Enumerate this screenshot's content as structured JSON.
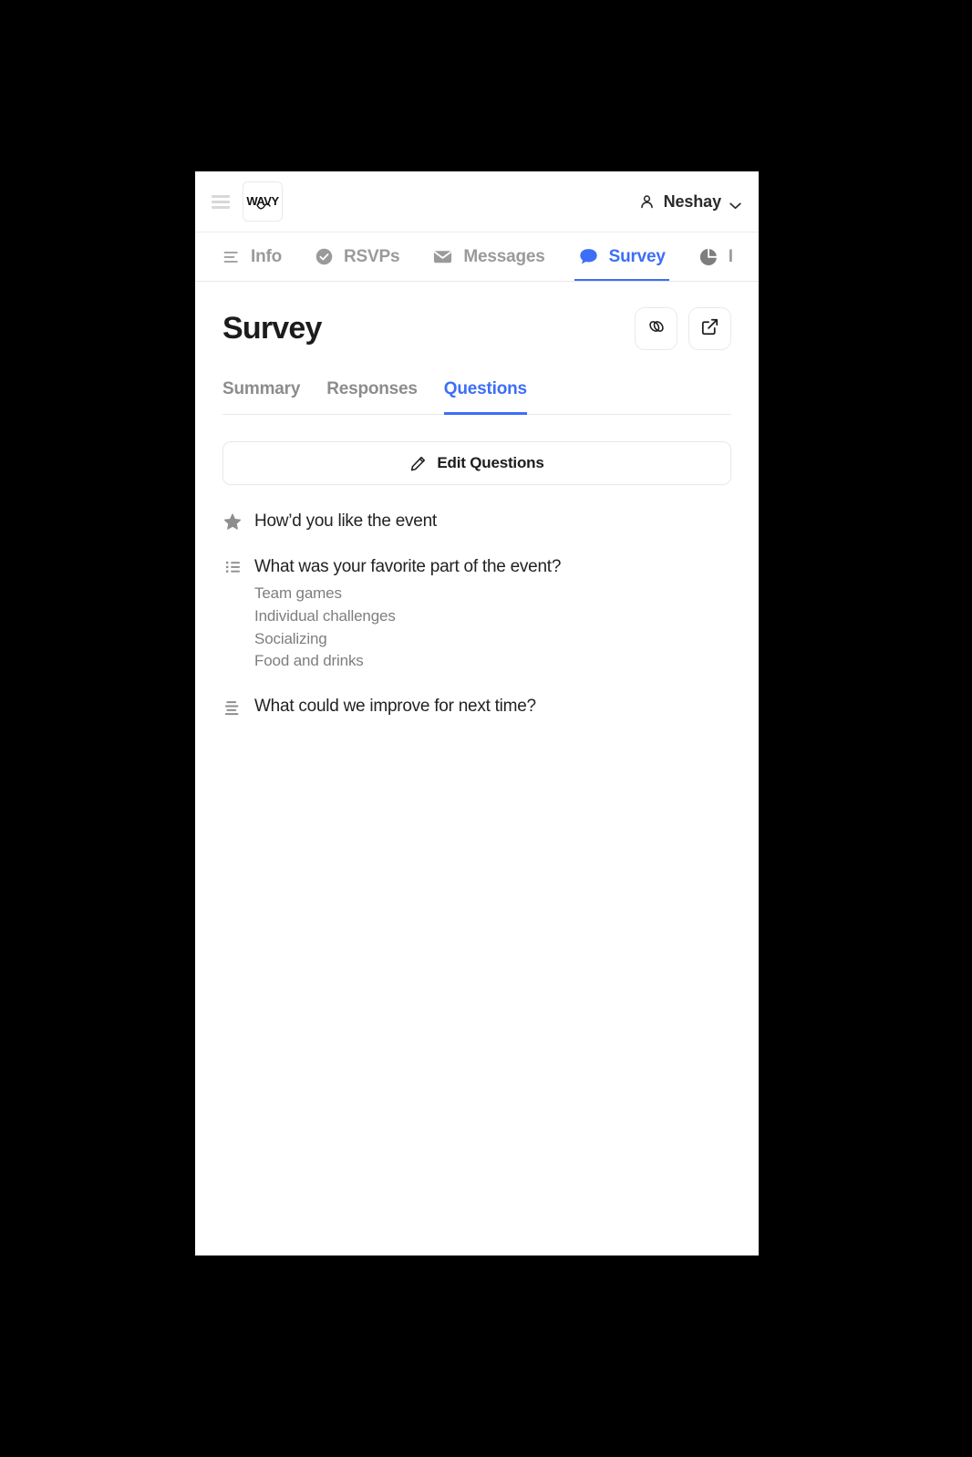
{
  "topbar": {
    "menu_icon": "hamburger-icon",
    "logo_text": "WAVY",
    "user_name": "Neshay",
    "user_icon": "person-icon",
    "chevron_icon": "chevron-down-icon"
  },
  "nav_tabs": [
    {
      "label": "Info",
      "icon": "text-align-icon",
      "active": false
    },
    {
      "label": "RSVPs",
      "icon": "check-circle-icon",
      "active": false
    },
    {
      "label": "Messages",
      "icon": "envelope-icon",
      "active": false
    },
    {
      "label": "Survey",
      "icon": "chat-bubble-icon",
      "active": true
    },
    {
      "label": "I",
      "icon": "pie-chart-icon",
      "active": false
    }
  ],
  "page": {
    "title": "Survey",
    "actions": [
      {
        "name": "copy-link-button",
        "icon": "link-icon"
      },
      {
        "name": "open-external-button",
        "icon": "external-link-icon"
      }
    ]
  },
  "sub_tabs": [
    {
      "label": "Summary",
      "active": false
    },
    {
      "label": "Responses",
      "active": false
    },
    {
      "label": "Questions",
      "active": true
    }
  ],
  "edit_button": {
    "label": "Edit Questions",
    "icon": "pencil-icon"
  },
  "questions": [
    {
      "text": "How’d you like the event",
      "icon": "star-icon",
      "options": []
    },
    {
      "text": "What was your favorite part of the event?",
      "icon": "bulleted-list-icon",
      "options": [
        "Team games",
        "Individual challenges",
        "Socializing",
        "Food and drinks"
      ]
    },
    {
      "text": "What could we improve for next time?",
      "icon": "text-align-icon",
      "options": []
    }
  ],
  "colors": {
    "accent": "#3d6ef7",
    "text_primary": "#1c1c1c",
    "text_muted": "#8c8c8c",
    "page_background": "#ffffff",
    "canvas_background": "#000000"
  }
}
